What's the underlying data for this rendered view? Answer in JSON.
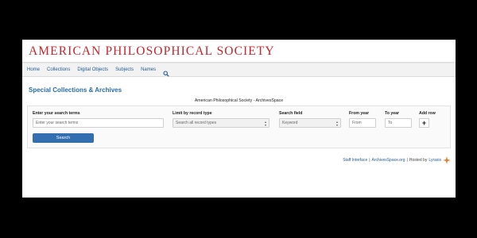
{
  "site": {
    "title": "AMERICAN PHILOSOPHICAL SOCIETY"
  },
  "nav": {
    "items": [
      "Home",
      "Collections",
      "Digital Objects",
      "Subjects",
      "Names"
    ],
    "search_icon": "search-icon"
  },
  "main": {
    "title": "Special Collections & Archives",
    "repository": "American Philosophical Society - ArchivesSpace"
  },
  "search": {
    "terms_label": "Enter your search terms",
    "terms_placeholder": "Enter your search terms",
    "limit_label": "Limit by record type",
    "limit_value": "Search all record types",
    "field_label": "Search field",
    "field_value": "Keyword",
    "from_label": "From year",
    "from_placeholder": "From",
    "to_label": "To year",
    "to_placeholder": "To",
    "add_row_label": "Add row",
    "add_row_symbol": "+",
    "button_label": "Search"
  },
  "footer": {
    "staff_link": "Staff Interface",
    "separator": "|",
    "archivesspace_link": "ArchivesSpace.org",
    "hosted_by": "Hosted by",
    "lyrasis_link": "Lyrasis"
  },
  "colors": {
    "brand_red": "#c8242b",
    "link_blue": "#1f5a94",
    "button_blue": "#336fb0",
    "lyrasis_orange": "#f0731e"
  }
}
